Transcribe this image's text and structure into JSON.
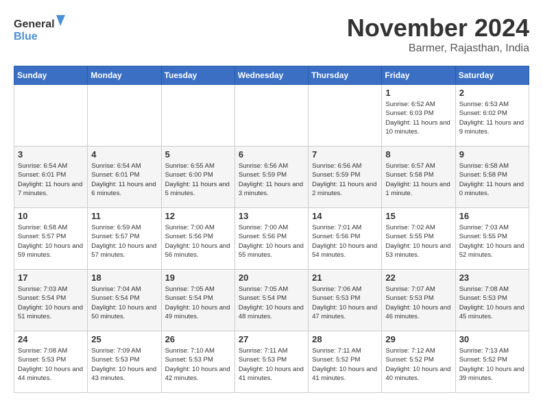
{
  "header": {
    "logo_line1": "General",
    "logo_line2": "Blue",
    "month_title": "November 2024",
    "location": "Barmer, Rajasthan, India"
  },
  "columns": [
    "Sunday",
    "Monday",
    "Tuesday",
    "Wednesday",
    "Thursday",
    "Friday",
    "Saturday"
  ],
  "weeks": [
    [
      {
        "day": "",
        "text": ""
      },
      {
        "day": "",
        "text": ""
      },
      {
        "day": "",
        "text": ""
      },
      {
        "day": "",
        "text": ""
      },
      {
        "day": "",
        "text": ""
      },
      {
        "day": "1",
        "text": "Sunrise: 6:52 AM\nSunset: 6:03 PM\nDaylight: 11 hours and 10 minutes."
      },
      {
        "day": "2",
        "text": "Sunrise: 6:53 AM\nSunset: 6:02 PM\nDaylight: 11 hours and 9 minutes."
      }
    ],
    [
      {
        "day": "3",
        "text": "Sunrise: 6:54 AM\nSunset: 6:01 PM\nDaylight: 11 hours and 7 minutes."
      },
      {
        "day": "4",
        "text": "Sunrise: 6:54 AM\nSunset: 6:01 PM\nDaylight: 11 hours and 6 minutes."
      },
      {
        "day": "5",
        "text": "Sunrise: 6:55 AM\nSunset: 6:00 PM\nDaylight: 11 hours and 5 minutes."
      },
      {
        "day": "6",
        "text": "Sunrise: 6:56 AM\nSunset: 5:59 PM\nDaylight: 11 hours and 3 minutes."
      },
      {
        "day": "7",
        "text": "Sunrise: 6:56 AM\nSunset: 5:59 PM\nDaylight: 11 hours and 2 minutes."
      },
      {
        "day": "8",
        "text": "Sunrise: 6:57 AM\nSunset: 5:58 PM\nDaylight: 11 hours and 1 minute."
      },
      {
        "day": "9",
        "text": "Sunrise: 6:58 AM\nSunset: 5:58 PM\nDaylight: 11 hours and 0 minutes."
      }
    ],
    [
      {
        "day": "10",
        "text": "Sunrise: 6:58 AM\nSunset: 5:57 PM\nDaylight: 10 hours and 59 minutes."
      },
      {
        "day": "11",
        "text": "Sunrise: 6:59 AM\nSunset: 5:57 PM\nDaylight: 10 hours and 57 minutes."
      },
      {
        "day": "12",
        "text": "Sunrise: 7:00 AM\nSunset: 5:56 PM\nDaylight: 10 hours and 56 minutes."
      },
      {
        "day": "13",
        "text": "Sunrise: 7:00 AM\nSunset: 5:56 PM\nDaylight: 10 hours and 55 minutes."
      },
      {
        "day": "14",
        "text": "Sunrise: 7:01 AM\nSunset: 5:56 PM\nDaylight: 10 hours and 54 minutes."
      },
      {
        "day": "15",
        "text": "Sunrise: 7:02 AM\nSunset: 5:55 PM\nDaylight: 10 hours and 53 minutes."
      },
      {
        "day": "16",
        "text": "Sunrise: 7:03 AM\nSunset: 5:55 PM\nDaylight: 10 hours and 52 minutes."
      }
    ],
    [
      {
        "day": "17",
        "text": "Sunrise: 7:03 AM\nSunset: 5:54 PM\nDaylight: 10 hours and 51 minutes."
      },
      {
        "day": "18",
        "text": "Sunrise: 7:04 AM\nSunset: 5:54 PM\nDaylight: 10 hours and 50 minutes."
      },
      {
        "day": "19",
        "text": "Sunrise: 7:05 AM\nSunset: 5:54 PM\nDaylight: 10 hours and 49 minutes."
      },
      {
        "day": "20",
        "text": "Sunrise: 7:05 AM\nSunset: 5:54 PM\nDaylight: 10 hours and 48 minutes."
      },
      {
        "day": "21",
        "text": "Sunrise: 7:06 AM\nSunset: 5:53 PM\nDaylight: 10 hours and 47 minutes."
      },
      {
        "day": "22",
        "text": "Sunrise: 7:07 AM\nSunset: 5:53 PM\nDaylight: 10 hours and 46 minutes."
      },
      {
        "day": "23",
        "text": "Sunrise: 7:08 AM\nSunset: 5:53 PM\nDaylight: 10 hours and 45 minutes."
      }
    ],
    [
      {
        "day": "24",
        "text": "Sunrise: 7:08 AM\nSunset: 5:53 PM\nDaylight: 10 hours and 44 minutes."
      },
      {
        "day": "25",
        "text": "Sunrise: 7:09 AM\nSunset: 5:53 PM\nDaylight: 10 hours and 43 minutes."
      },
      {
        "day": "26",
        "text": "Sunrise: 7:10 AM\nSunset: 5:53 PM\nDaylight: 10 hours and 42 minutes."
      },
      {
        "day": "27",
        "text": "Sunrise: 7:11 AM\nSunset: 5:53 PM\nDaylight: 10 hours and 41 minutes."
      },
      {
        "day": "28",
        "text": "Sunrise: 7:11 AM\nSunset: 5:52 PM\nDaylight: 10 hours and 41 minutes."
      },
      {
        "day": "29",
        "text": "Sunrise: 7:12 AM\nSunset: 5:52 PM\nDaylight: 10 hours and 40 minutes."
      },
      {
        "day": "30",
        "text": "Sunrise: 7:13 AM\nSunset: 5:52 PM\nDaylight: 10 hours and 39 minutes."
      }
    ]
  ]
}
